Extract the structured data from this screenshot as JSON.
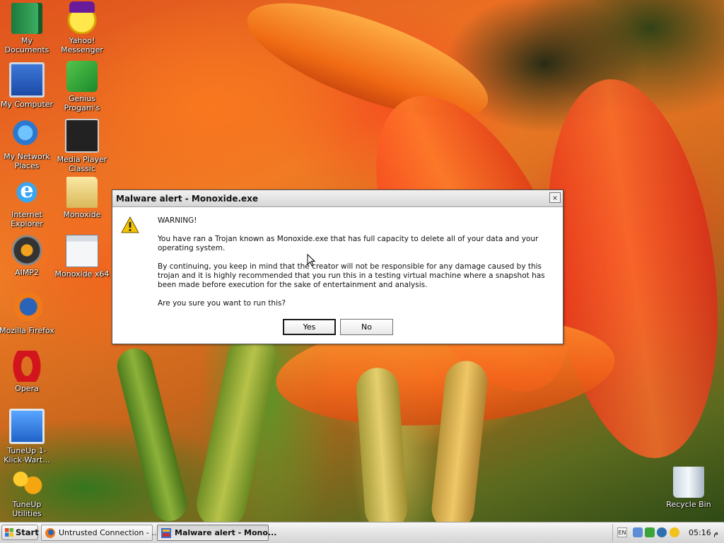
{
  "desktop": {
    "icons_left": [
      {
        "label": "My Documents",
        "icon": "my-documents-icon"
      },
      {
        "label": "My Computer",
        "icon": "my-computer-icon"
      },
      {
        "label": "My Network Places",
        "icon": "network-places-icon"
      },
      {
        "label": "Internet Explorer",
        "icon": "internet-explorer-icon"
      },
      {
        "label": "AIMP2",
        "icon": "aimp-icon"
      },
      {
        "label": "Mozilla Firefox",
        "icon": "firefox-icon"
      },
      {
        "label": "Opera",
        "icon": "opera-icon"
      },
      {
        "label": "TuneUp 1-Klick-Wart...",
        "icon": "tuneup-monitor-icon"
      },
      {
        "label": "TuneUp Utilities",
        "icon": "tuneup-utilities-icon"
      }
    ],
    "icons_right_col": [
      {
        "label": "Yahoo! Messenger",
        "icon": "yahoo-messenger-icon"
      },
      {
        "label": "Genius Progam's",
        "icon": "genius-icon"
      },
      {
        "label": "Media Player Classic",
        "icon": "media-player-classic-icon"
      },
      {
        "label": "Monoxide",
        "icon": "folder-icon"
      },
      {
        "label": "Monoxide x64",
        "icon": "window-icon"
      }
    ],
    "recycle_bin": {
      "label": "Recycle Bin",
      "icon": "recycle-bin-icon"
    }
  },
  "dialog": {
    "title": "Malware alert - Monoxide.exe",
    "close_label": "×",
    "heading": "WARNING!",
    "paragraph1": "You have ran a Trojan known as Monoxide.exe that has full capacity to delete all of your data and your operating system.",
    "paragraph2": "By continuing, you keep in mind that the creator will not be responsible for any damage caused by this trojan and it is highly recommended that you run this in a testing virtual machine where a snapshot has been made before execution for the sake of entertainment and analysis.",
    "question": "Are you sure you want to run this?",
    "yes_label": "Yes",
    "no_label": "No",
    "icon": "warning-icon"
  },
  "taskbar": {
    "start_label": "Start",
    "tasks": [
      {
        "label": "Untrusted Connection - ...",
        "icon": "firefox-icon",
        "active": false
      },
      {
        "label": "Malware alert - Mono...",
        "icon": "app-icon",
        "active": true
      }
    ],
    "tray": {
      "language": "EN",
      "clock": "05:16 م"
    }
  },
  "colors": {
    "dialog_titlebar": "#d6d6d6",
    "taskbar": "#e3e3e3",
    "icon_label": "#ffffff"
  }
}
